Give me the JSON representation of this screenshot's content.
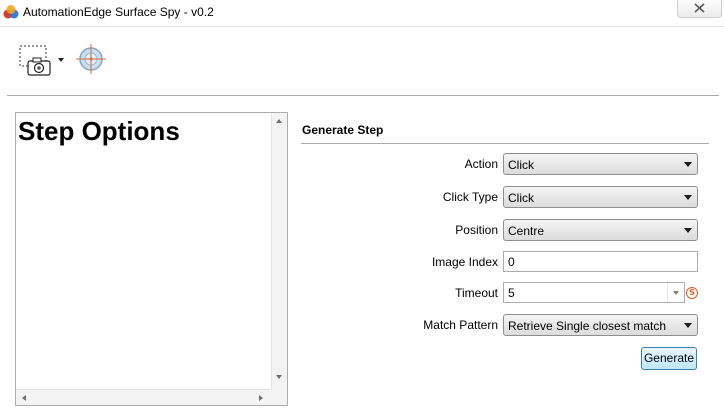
{
  "window": {
    "title": "AutomationEdge Surface Spy - v0.2"
  },
  "toolbar": {
    "capture_icon": "screen-capture-camera-icon",
    "target_icon": "crosshair-target-icon"
  },
  "left_panel": {
    "heading": "Step Options"
  },
  "generate_step": {
    "title": "Generate Step",
    "fields": {
      "action": {
        "label": "Action",
        "value": "Click"
      },
      "click_type": {
        "label": "Click Type",
        "value": "Click"
      },
      "position": {
        "label": "Position",
        "value": "Centre"
      },
      "image_index": {
        "label": "Image Index",
        "value": "0"
      },
      "timeout": {
        "label": "Timeout",
        "value": "5",
        "unit_icon": "seconds-s-icon"
      },
      "match_pattern": {
        "label": "Match Pattern",
        "value": "Retrieve Single closest match"
      }
    },
    "generate_label": "Generate"
  },
  "colors": {
    "button_border": "#3c7fb1",
    "seconds_icon": "#e05a1c"
  }
}
